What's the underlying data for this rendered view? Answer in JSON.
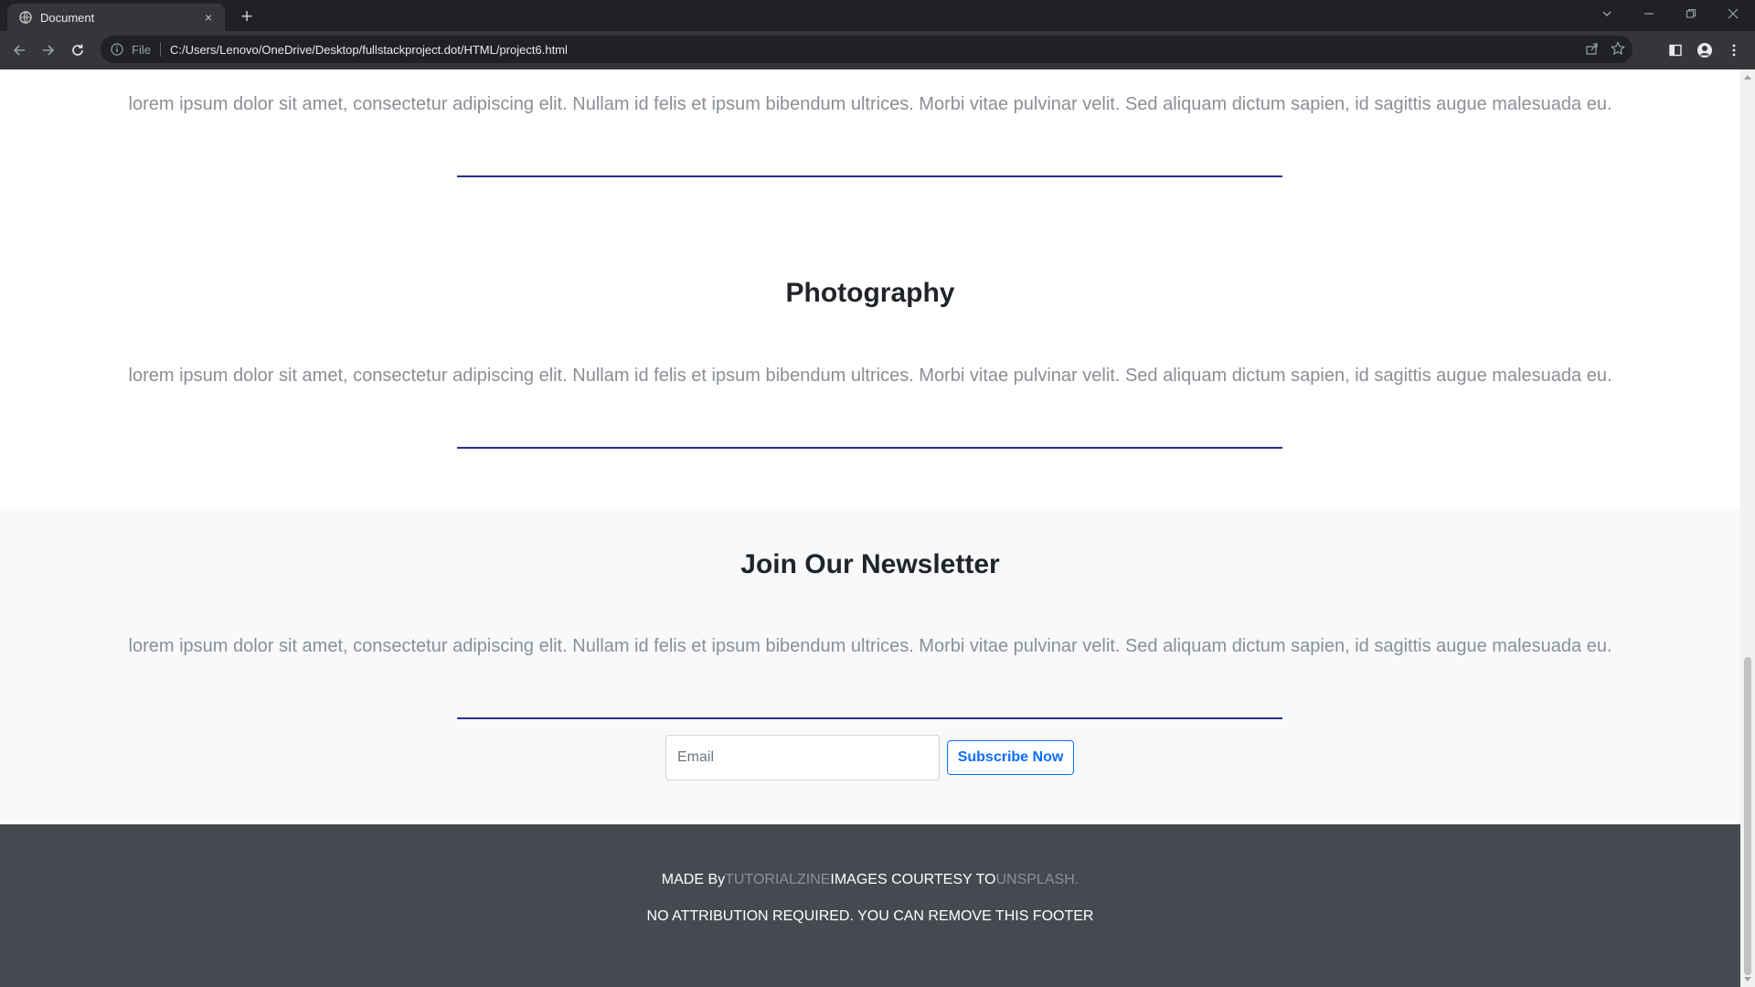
{
  "browser": {
    "tab_title": "Document",
    "tab_close": "×",
    "new_tab": "+",
    "address_prefix": "File",
    "url": "C:/Users/Lenovo/OneDrive/Desktop/fullstackproject.dot/HTML/project6.html"
  },
  "sections": [
    {
      "paragraph": "lorem ipsum dolor sit amet, consectetur adipiscing elit. Nullam id felis et ipsum bibendum ultrices. Morbi vitae pulvinar velit. Sed aliquam dictum sapien, id sagittis augue malesuada eu."
    },
    {
      "title": "Photography",
      "paragraph": "lorem ipsum dolor sit amet, consectetur adipiscing elit. Nullam id felis et ipsum bibendum ultrices. Morbi vitae pulvinar velit. Sed aliquam dictum sapien, id sagittis augue malesuada eu."
    }
  ],
  "newsletter": {
    "title": "Join Our Newsletter",
    "paragraph": "lorem ipsum dolor sit amet, consectetur adipiscing elit. Nullam id felis et ipsum bibendum ultrices. Morbi vitae pulvinar velit. Sed aliquam dictum sapien, id sagittis augue malesuada eu.",
    "email_placeholder": "Email",
    "button_label": "Subscribe Now"
  },
  "footer": {
    "made_by": "MADE By",
    "made_by_link": "TUTORIALZINE",
    "images_courtesy": "IMAGES COURTESY TO",
    "images_link": "UNSPLASH.",
    "line2": "NO ATTRIBUTION REQUIRED. YOU CAN REMOVE THIS FOOTER"
  },
  "colors": {
    "accent": "#0d6efd",
    "rule": "#2b2f8a",
    "footer_bg": "#454a51",
    "newsletter_bg": "#f8f9fa"
  }
}
